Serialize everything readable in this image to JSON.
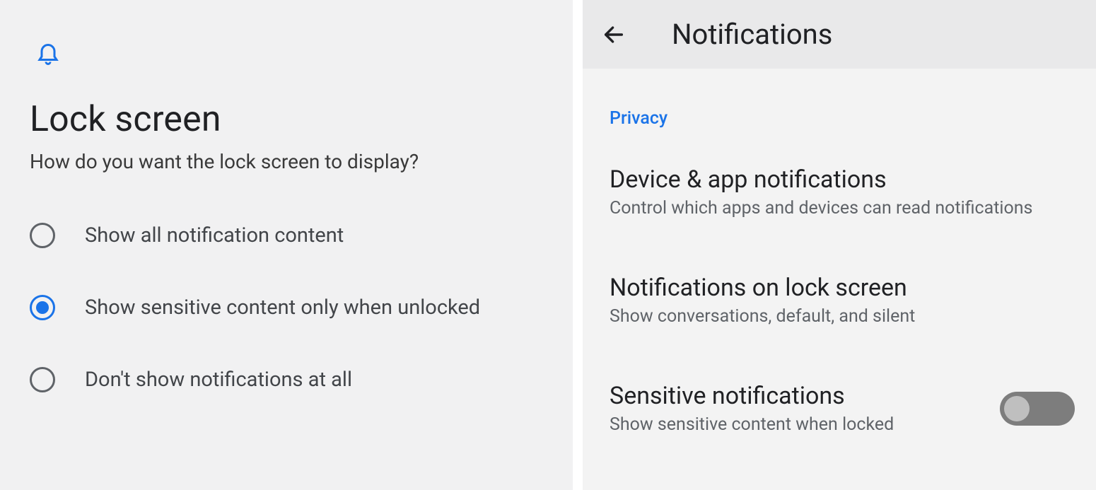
{
  "left": {
    "title": "Lock screen",
    "subtitle": "How do you want the lock screen to display?",
    "options": [
      {
        "label": "Show all notification content",
        "selected": false
      },
      {
        "label": "Show sensitive content only when unlocked",
        "selected": true
      },
      {
        "label": "Don't show notifications at all",
        "selected": false
      }
    ]
  },
  "right": {
    "appbar_title": "Notifications",
    "section": "Privacy",
    "items": [
      {
        "title": "Device & app notifications",
        "sub": "Control which apps and devices can read notifications",
        "toggle": null
      },
      {
        "title": "Notifications on lock screen",
        "sub": "Show conversations, default, and silent",
        "toggle": null
      },
      {
        "title": "Sensitive notifications",
        "sub": "Show sensitive content when locked",
        "toggle": false
      }
    ]
  }
}
